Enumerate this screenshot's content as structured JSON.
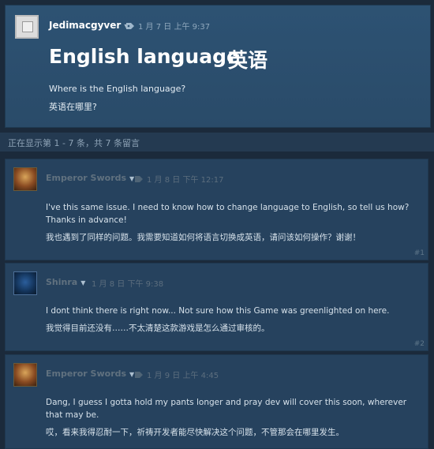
{
  "topic": {
    "author": "Jedimacgyver",
    "timestamp": "1 月 7 日 上午 9:37",
    "title_en": "English language",
    "title_zh": "英语",
    "body_en": "Where is the English language?",
    "body_zh": "英语在哪里?"
  },
  "count_text": "正在显示第 1 - 7 条，共 7 条留言",
  "comments": [
    {
      "author": "Emperor Swords",
      "timestamp": "1 月 8 日 下午 12:17",
      "body": "I've this same issue. I need to know how to change language to English, so tell us how? Thanks in advance!",
      "translation": "我也遇到了同样的问题。我需要知道如何将语言切换成英语，请问该如何操作？谢谢！",
      "number": "#1"
    },
    {
      "author": "Shinra",
      "timestamp": "1 月 8 日 下午 9:38",
      "body": "I dont think there is right now... Not sure how this Game was greenlighted on here.",
      "translation": "我觉得目前还没有……不太清楚这款游戏是怎么通过审核的。",
      "number": "#2"
    },
    {
      "author": "Emperor Swords",
      "timestamp": "1 月 9 日 上午 4:45",
      "body": "Dang, I guess I gotta hold my pants longer and pray dev will cover this soon, wherever that may be.",
      "translation": "哎，看来我得忍耐一下，祈祷开发者能尽快解决这个问题，不管那会在哪里发生。",
      "number": ""
    }
  ],
  "icons": {
    "caret": "caret-down-icon",
    "pin": "tag-icon"
  }
}
